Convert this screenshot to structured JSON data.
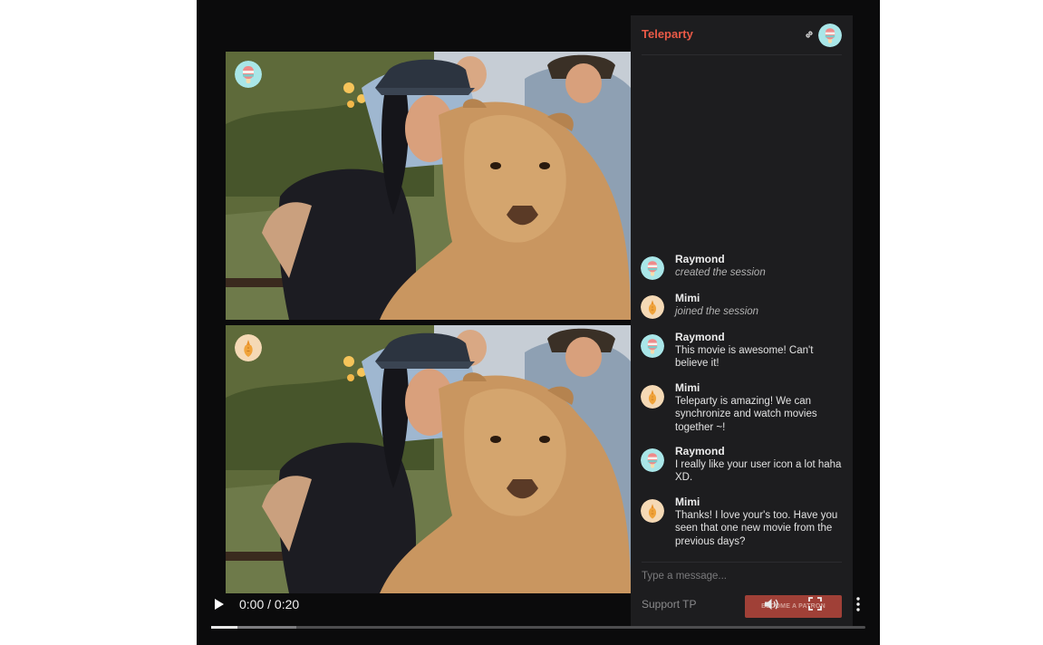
{
  "chat": {
    "brand": "Teleparty",
    "input_placeholder": "Type a message...",
    "support_label": "Support TP",
    "become_button_label": "BECOME A PATRON",
    "messages": [
      {
        "name": "Raymond",
        "text": "created the session",
        "icon": "popsicle-avatar",
        "system": true
      },
      {
        "name": "Mimi",
        "text": "joined the session",
        "icon": "carrot-avatar",
        "system": true
      },
      {
        "name": "Raymond",
        "text": "This movie is awesome! Can't believe it!",
        "icon": "popsicle-avatar",
        "system": false
      },
      {
        "name": "Mimi",
        "text": "Teleparty is amazing! We can synchronize and watch movies together ~!",
        "icon": "carrot-avatar",
        "system": false
      },
      {
        "name": "Raymond",
        "text": "I really like your user icon a lot haha XD.",
        "icon": "popsicle-avatar",
        "system": false
      },
      {
        "name": "Mimi",
        "text": "Thanks! I love your's too. Have you seen that one new movie from the previous days?",
        "icon": "carrot-avatar",
        "system": false
      }
    ]
  },
  "player": {
    "time": "0:00 / 0:20",
    "progress_played": 0.04,
    "progress_buffered": 0.13
  },
  "colors": {
    "brand": "#ea5a47",
    "popsicle_bg": "#a9e6e8",
    "carrot_bg": "#f5d9b5"
  }
}
